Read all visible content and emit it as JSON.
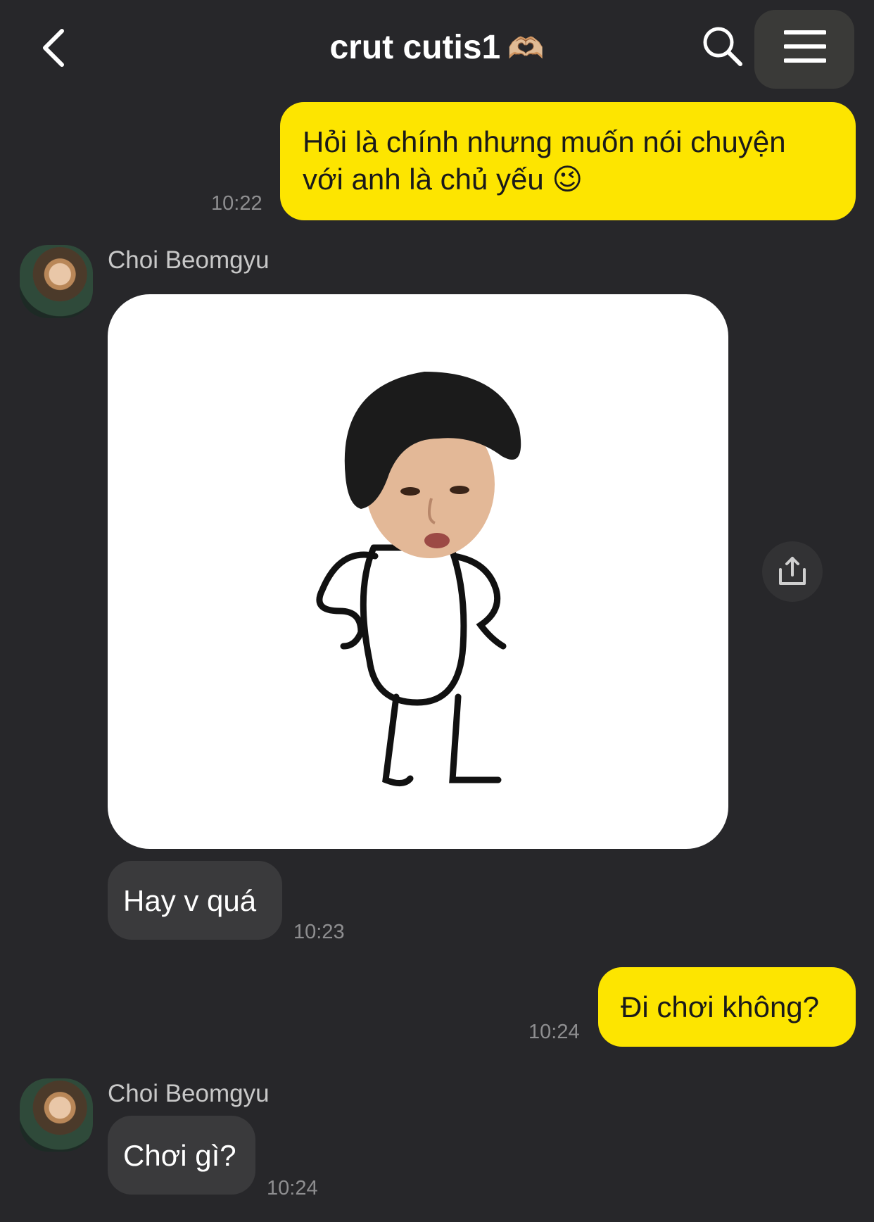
{
  "header": {
    "title": "crut cutis1",
    "title_emoji": "🫶🏼",
    "back_icon": "chevron-left-icon",
    "search_icon": "search-icon",
    "menu_icon": "menu-icon"
  },
  "messages": [
    {
      "from": "me",
      "text_line1": "Hỏi là chính nhưng muốn nói chuyện",
      "text_line2": "với anh là chủ yếu 😉",
      "time": "10:22"
    },
    {
      "from": "other",
      "sender": "Choi Beomgyu",
      "type": "sticker",
      "sticker_icon": "stick-figure-sticker"
    },
    {
      "from": "other",
      "text": "Hay v quá",
      "time": "10:23"
    },
    {
      "from": "me",
      "text": "Đi chơi không?",
      "time": "10:24"
    },
    {
      "from": "other",
      "sender": "Choi Beomgyu",
      "text": "Chơi gì?",
      "time": "10:24"
    }
  ],
  "colors": {
    "background": "#27272a",
    "my_bubble": "#fde500",
    "their_bubble": "#3a3a3c"
  },
  "share_icon": "share-icon"
}
